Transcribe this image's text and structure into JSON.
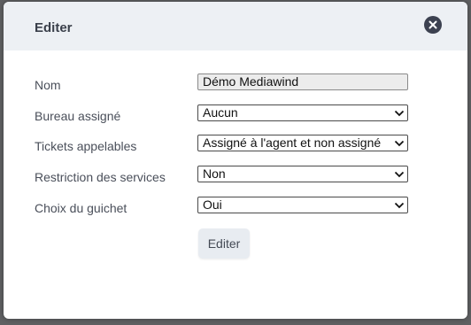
{
  "dialog": {
    "title": "Editer",
    "close_icon": "close-icon"
  },
  "form": {
    "nom": {
      "label": "Nom",
      "value": "Démo Mediawind"
    },
    "bureau": {
      "label": "Bureau assigné",
      "value": "Aucun"
    },
    "tickets": {
      "label": "Tickets appelables",
      "value": "Assigné à l'agent et non assigné"
    },
    "restriction": {
      "label": "Restriction des services",
      "value": "Non"
    },
    "guichet": {
      "label": "Choix du guichet",
      "value": "Oui"
    }
  },
  "submit": {
    "label": "Editer"
  },
  "colors": {
    "header_bg": "#edf0f4",
    "close_bg": "#3c4150",
    "button_bg": "#e8ecf1"
  }
}
